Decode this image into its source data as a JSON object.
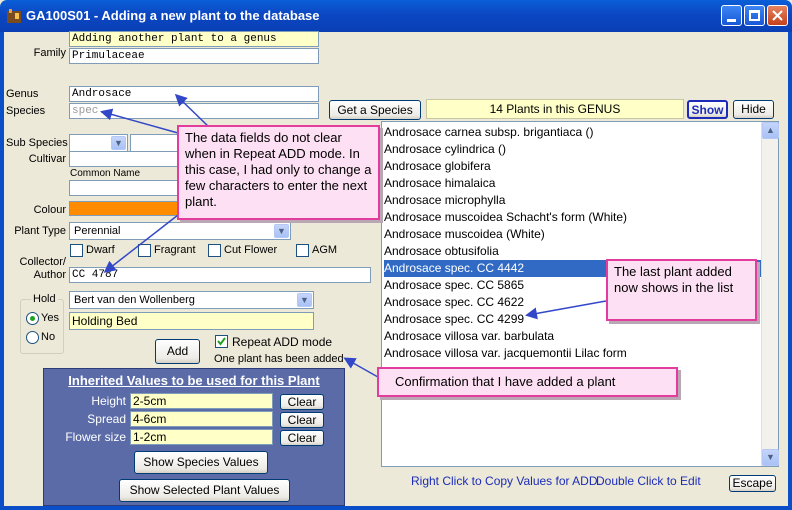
{
  "window": {
    "title": "GA100S01 - Adding a new plant to the database"
  },
  "form": {
    "top_field": "Adding another plant to a genus",
    "family_label": "Family",
    "family_value": "Primulaceae",
    "genus_label": "Genus",
    "genus_value": "Androsace",
    "species_label": "Species",
    "species_placeholder": "spec.",
    "subspecies_label": "Sub Species",
    "cultivar_label": "Cultivar",
    "common_name_label": "Common Name",
    "colour_label": "Colour",
    "plant_type_label": "Plant Type",
    "plant_type_value": "Perennial",
    "checkboxes": [
      {
        "label": "Dwarf",
        "checked": false
      },
      {
        "label": "Fragrant",
        "checked": false
      },
      {
        "label": "Cut Flower",
        "checked": false
      },
      {
        "label": "AGM",
        "checked": false
      }
    ],
    "collector_label_1": "Collector/",
    "collector_label_2": "Author",
    "collector_value": "CC 4787",
    "hold_label": "Hold",
    "hold_yes": "Yes",
    "hold_no": "No",
    "hold_combo_value": "Bert van den Wollenberg",
    "hold_text": "Holding Bed",
    "add_button": "Add",
    "repeat_add_label": "Repeat ADD mode",
    "status_text": "One plant has been added",
    "colour_swatch": "#ff8c00"
  },
  "species_panel": {
    "get_species_button": "Get a Species",
    "count_text": "14 Plants in this GENUS",
    "show_button": "Show",
    "hide_button": "Hide",
    "items": [
      "Androsace carnea subsp. brigantiaca ()",
      "Androsace cylindrica ()",
      "Androsace globifera",
      "Androsace himalaica",
      "Androsace microphylla",
      "Androsace muscoidea Schacht's form (White)",
      "Androsace muscoidea (White)",
      "Androsace obtusifolia",
      "Androsace spec. CC 4442",
      "Androsace spec. CC 5865",
      "Androsace spec. CC 4622",
      "Androsace spec. CC 4299",
      "Androsace villosa var. barbulata",
      "Androsace villosa var. jacquemontii Lilac form"
    ],
    "selected_index": 8,
    "hint_copy": "Right Click to Copy Values for ADD.",
    "hint_edit": "Double Click to Edit",
    "escape_button": "Escape"
  },
  "inherited": {
    "heading": "Inherited Values to be used for this Plant",
    "height_label": "Height",
    "height_value": "2-5cm",
    "spread_label": "Spread",
    "spread_value": "4-6cm",
    "flower_label": "Flower size",
    "flower_value": "1-2cm",
    "clear_label": "Clear",
    "show_species_button": "Show Species Values",
    "show_selected_button": "Show Selected Plant Values"
  },
  "callouts": {
    "fields": "The data fields do not clear when in Repeat ADD mode. In this case, I had only to change a few characters to enter the next plant.",
    "last_plant": "The last plant added now shows in the list",
    "confirmation": "Confirmation that I have added a plant"
  }
}
